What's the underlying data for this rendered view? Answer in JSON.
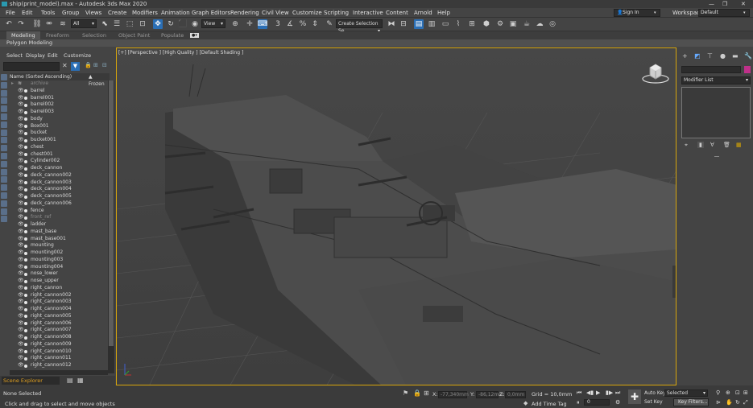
{
  "window": {
    "title": "ship(print_model).max - Autodesk 3ds Max 2020"
  },
  "menu": [
    "File",
    "Edit",
    "Tools",
    "Group",
    "Views",
    "Create",
    "Modifiers",
    "Animation",
    "Graph Editors",
    "Rendering",
    "Civil View",
    "Customize",
    "Scripting",
    "Interactive",
    "Content",
    "Arnold",
    "Help"
  ],
  "account": {
    "sign_in": "Sign In",
    "workspaces_label": "Workspaces:",
    "workspace_value": "Default"
  },
  "toolbar": {
    "filter_value": "All",
    "coord_value": "View",
    "selection_set": "Create Selection Se"
  },
  "ribbon": {
    "tabs": [
      "Modeling",
      "Freeform",
      "Selection",
      "Object Paint",
      "Populate"
    ],
    "active_panel": "Polygon Modeling"
  },
  "scene_explorer": {
    "menu": [
      "Select",
      "Display",
      "Edit",
      "Customize"
    ],
    "column_header": "Name (Sorted Ascending)",
    "frozen_header": "▲ Frozen",
    "root": "archive",
    "items": [
      "barrel",
      "barrel001",
      "barrel002",
      "barrel003",
      "body",
      "Box001",
      "bucket",
      "bucket001",
      "chest",
      "chest001",
      "Cylinder002",
      "deck_cannon",
      "deck_cannon002",
      "deck_cannon003",
      "deck_cannon004",
      "deck_cannon005",
      "deck_cannon006",
      "fence",
      "front_ref",
      "ladder",
      "mast_base",
      "mast_base001",
      "mounting",
      "mounting002",
      "mounting003",
      "mounting004",
      "nose_lower",
      "nose_upper",
      "right_cannon",
      "right_cannon002",
      "right_cannon003",
      "right_cannon004",
      "right_cannon005",
      "right_cannon006",
      "right_cannon007",
      "right_cannon008",
      "right_cannon009",
      "right_cannon010",
      "right_cannon011",
      "right_cannon012"
    ],
    "dimmed": [
      "archive",
      "front_ref"
    ],
    "tab_label": "Scene Explorer"
  },
  "viewport": {
    "label": "[+] [Perspective ] [High Quality ] [Default Shading ]"
  },
  "command_panel": {
    "modifier_list": "Modifier List"
  },
  "status": {
    "selection": "None Selected",
    "hint": "Click and drag to select and move objects",
    "x_label": "X:",
    "x_value": "-77,340mm",
    "y_label": "Y:",
    "y_value": "-86,12mm",
    "z_label": "Z:",
    "z_value": "0,0mm",
    "grid": "Grid = 10,0mm",
    "add_time_tag": "Add Time Tag",
    "frame": "0",
    "auto_key": "Auto Key",
    "set_key": "Set Key",
    "selected": "Selected",
    "key_filters": "Key Filters..."
  },
  "colors": {
    "accent_blue": "#2b6fb5",
    "viewport_border": "#d7a50c",
    "object_color": "#c0308a"
  }
}
